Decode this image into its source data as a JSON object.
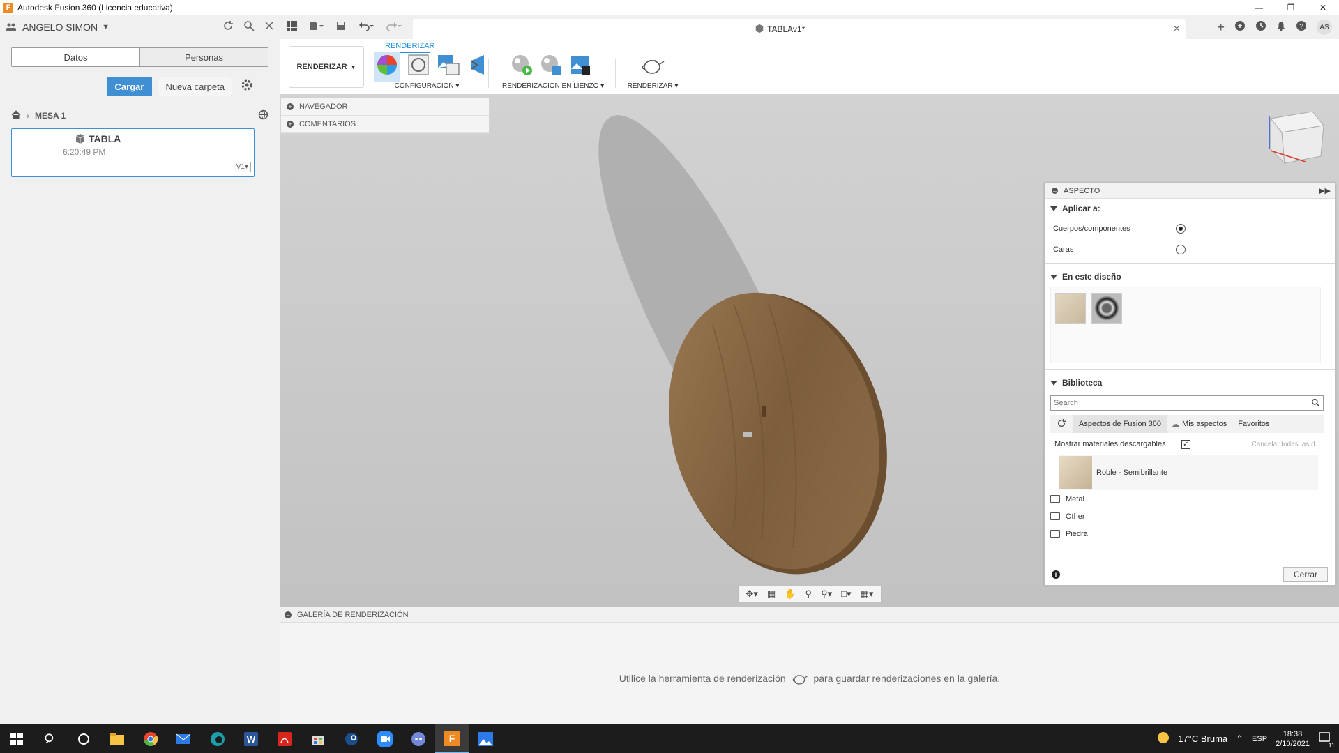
{
  "window": {
    "title": "Autodesk Fusion 360 (Licencia educativa)"
  },
  "data_panel": {
    "user": "ANGELO SIMON",
    "tabs": [
      "Datos",
      "Personas"
    ],
    "upload_label": "Cargar",
    "new_folder_label": "Nueva carpeta",
    "breadcrumb": "MESA 1",
    "file": {
      "name": "TABLA",
      "time": "6:20:49 PM",
      "version": "V1"
    }
  },
  "app_bar": {
    "document_tab": "TABLAv1*",
    "avatar": "AS"
  },
  "ribbon": {
    "tab": "RENDERIZAR",
    "workspace": "RENDERIZAR",
    "groups": [
      {
        "label": "CONFIGURACIÓN"
      },
      {
        "label": "RENDERIZACIÓN EN LIENZO"
      },
      {
        "label": "RENDERIZAR"
      }
    ]
  },
  "browser": {
    "rows": [
      "NAVEGADOR",
      "COMENTARIOS"
    ]
  },
  "appearance_panel": {
    "title": "ASPECTO",
    "apply_to": {
      "title": "Aplicar a:",
      "options": [
        {
          "label": "Cuerpos/componentes",
          "selected": true
        },
        {
          "label": "Caras",
          "selected": false
        }
      ]
    },
    "in_design": {
      "title": "En este diseño"
    },
    "library": {
      "title": "Biblioteca",
      "search_placeholder": "Search",
      "tabs": [
        "Aspectos de Fusion 360",
        "Mis aspectos",
        "Favoritos"
      ],
      "show_downloadable": "Mostrar materiales descargables",
      "cancel_all": "Cancelar todas las d...",
      "item": "Roble - Semibrillante",
      "folders": [
        "Metal",
        "Other",
        "Piedra"
      ]
    },
    "close_label": "Cerrar"
  },
  "gallery": {
    "title": "GALERÍA DE RENDERIZACIÓN",
    "message_before": "Utilice la herramienta de renderización",
    "message_after": "para guardar renderizaciones en la galería."
  },
  "taskbar": {
    "weather": "17°C  Bruma",
    "lang": "ESP",
    "time": "18:38",
    "date": "2/10/2021",
    "notifications": "11"
  },
  "colors": {
    "accent": "#3f8fd2",
    "wood": "#8a6a45",
    "viewport_bg": "#c8c8c8"
  }
}
